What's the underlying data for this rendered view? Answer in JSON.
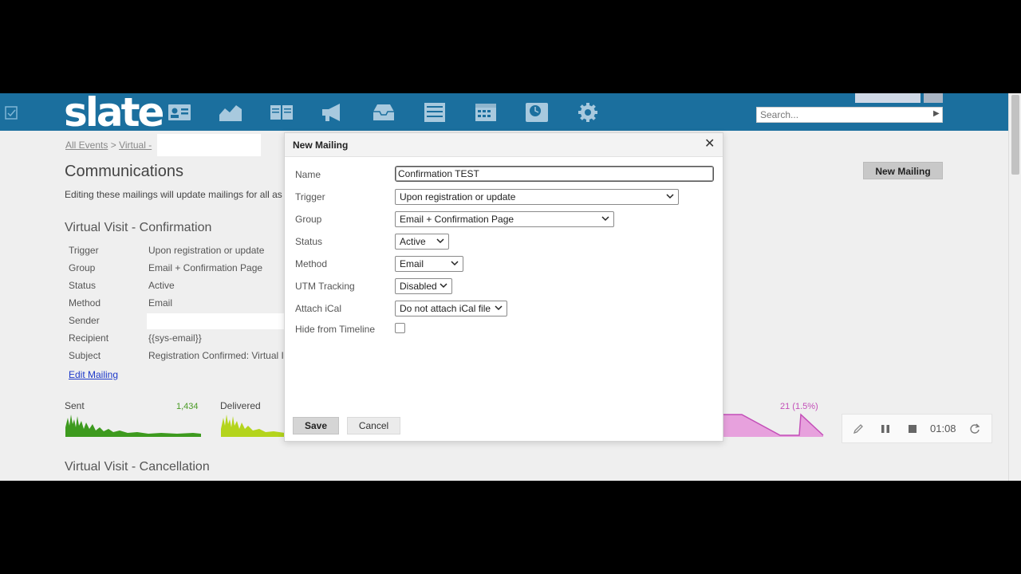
{
  "app": {
    "logo": "slate"
  },
  "topbar": {
    "icons": [
      "contacts-icon",
      "reports-icon",
      "book-icon",
      "megaphone-icon",
      "inbox-icon",
      "list-icon",
      "calendar-icon",
      "clock-icon",
      "gear-icon"
    ],
    "search_placeholder": "Search...",
    "color": "#1b6f9e"
  },
  "breadcrumb": {
    "item1": "All Events",
    "sep": ">",
    "item2": "Virtual -"
  },
  "page": {
    "title": "Communications",
    "description": "Editing these mailings will update mailings for all as",
    "new_mailing_label": "New Mailing",
    "section_title": "Virtual Visit - Confirmation",
    "section_title_2": "Virtual Visit - Cancellation",
    "edit_mailing_label": "Edit Mailing",
    "properties": [
      {
        "label": "Trigger",
        "value": "Upon registration or update"
      },
      {
        "label": "Group",
        "value": "Email + Confirmation Page"
      },
      {
        "label": "Status",
        "value": "Active"
      },
      {
        "label": "Method",
        "value": "Email"
      },
      {
        "label": "Sender",
        "value": ""
      },
      {
        "label": "Recipient",
        "value": "{{sys-email}}"
      },
      {
        "label": "Subject",
        "value": "Registration Confirmed: Virtual I"
      }
    ],
    "stats": {
      "sent_label": "Sent",
      "sent_value": "1,434",
      "delivered_label": "Delivered",
      "right_value": "21 (1.5%)",
      "sent_color": "#3d9a1e",
      "delivered_color": "#b4d41c",
      "right_color": "#e7a1dd"
    }
  },
  "recorder": {
    "time": "01:08"
  },
  "modal": {
    "title": "New Mailing",
    "fields": {
      "name_label": "Name",
      "name_value": "Confirmation TEST",
      "trigger_label": "Trigger",
      "trigger_value": "Upon registration or update",
      "group_label": "Group",
      "group_value": "Email + Confirmation Page",
      "status_label": "Status",
      "status_value": "Active",
      "method_label": "Method",
      "method_value": "Email",
      "utm_label": "UTM Tracking",
      "utm_value": "Disabled",
      "ical_label": "Attach iCal",
      "ical_value": "Do not attach iCal file",
      "hide_label": "Hide from Timeline"
    },
    "save_label": "Save",
    "cancel_label": "Cancel"
  }
}
